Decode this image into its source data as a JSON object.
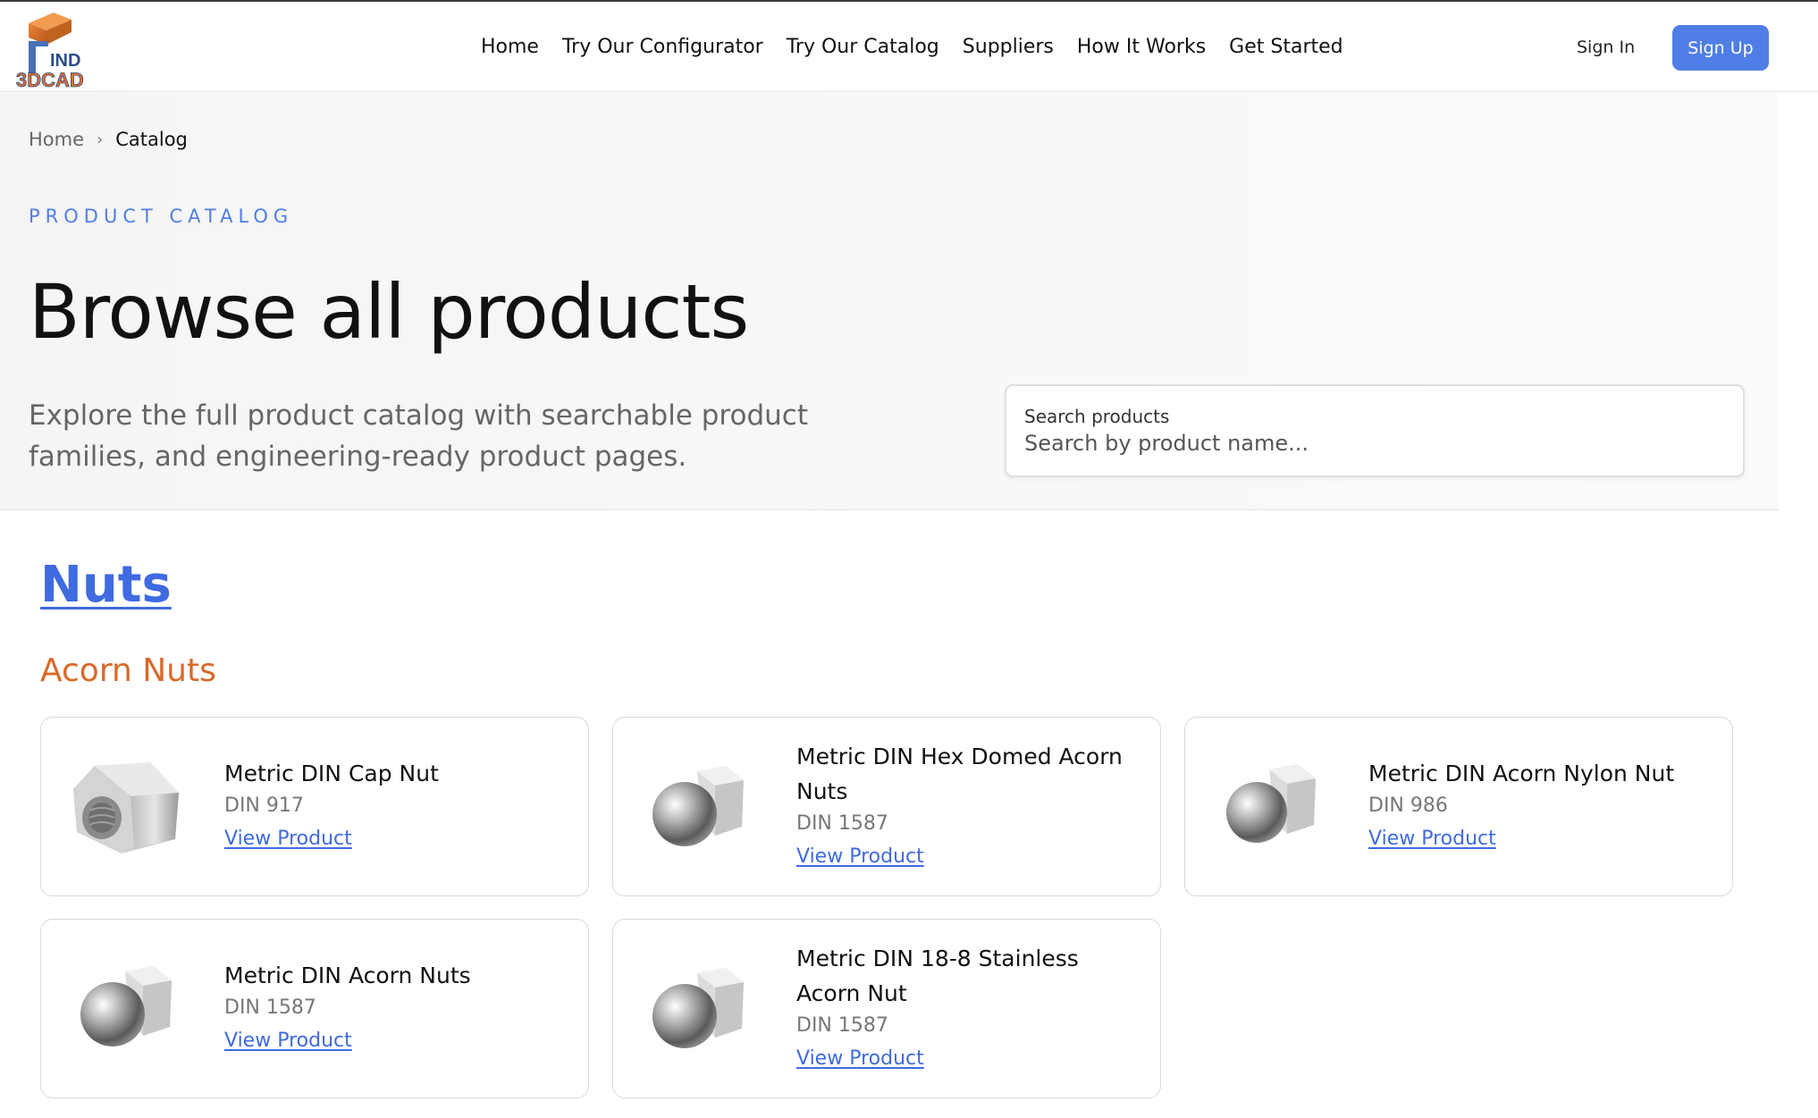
{
  "brand": {
    "logo_text_top": "IND",
    "logo_text_bottom": "3DCAD"
  },
  "nav": {
    "items": [
      {
        "label": "Home"
      },
      {
        "label": "Try Our Configurator"
      },
      {
        "label": "Try Our Catalog"
      },
      {
        "label": "Suppliers"
      },
      {
        "label": "How It Works"
      },
      {
        "label": "Get Started"
      }
    ],
    "sign_in": "Sign In",
    "sign_up": "Sign Up"
  },
  "breadcrumb": {
    "home": "Home",
    "separator": "›",
    "current": "Catalog"
  },
  "hero": {
    "eyebrow": "PRODUCT CATALOG",
    "title": "Browse all products",
    "description": "Explore the full product catalog with searchable product families, and engineering-ready product pages."
  },
  "search": {
    "label": "Search products",
    "placeholder": "Search by product name...",
    "value": ""
  },
  "catalog": {
    "section": "Nuts",
    "subsection": "Acorn Nuts",
    "link_label": "View Product",
    "products": [
      {
        "name": "Metric DIN Cap Nut",
        "standard": "DIN 917",
        "icon": "cap-nut-icon"
      },
      {
        "name": "Metric DIN Hex Domed Acorn Nuts",
        "standard": "DIN 1587",
        "icon": "acorn-nut-icon"
      },
      {
        "name": "Metric DIN Acorn Nylon Nut",
        "standard": "DIN 986",
        "icon": "acorn-nut-icon"
      },
      {
        "name": "Metric DIN Acorn Nuts",
        "standard": "DIN 1587",
        "icon": "acorn-nut-icon"
      },
      {
        "name": "Metric DIN 18-8 Stainless Acorn Nut",
        "standard": "DIN 1587",
        "icon": "acorn-nut-icon"
      }
    ]
  },
  "colors": {
    "accent": "#4f7ee6",
    "link": "#3f6ae0",
    "subsection": "#d9692a"
  }
}
